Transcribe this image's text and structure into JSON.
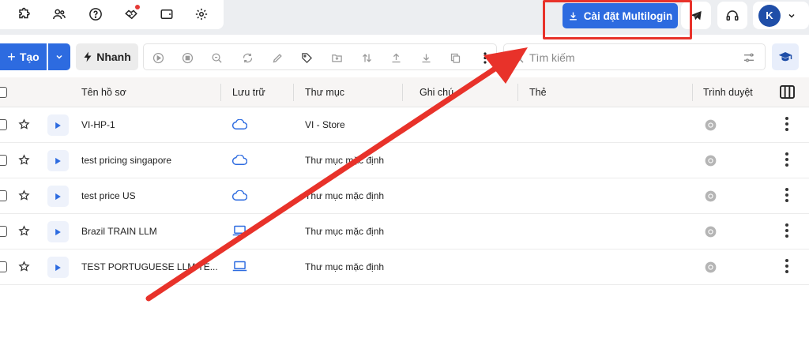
{
  "top_icons": [
    "puzzle-icon",
    "users-icon",
    "help-icon",
    "handshake-icon",
    "wallet-icon",
    "gear-icon"
  ],
  "install_button": {
    "label": "Cài đặt Multilogin",
    "icon": "download-icon"
  },
  "account": {
    "avatar_letter": "K"
  },
  "toolbar": {
    "create_label": "Tạo",
    "quick_label": "Nhanh",
    "action_icons": [
      "play-icon",
      "stop-icon",
      "zoom-icon",
      "refresh-icon",
      "pencil-icon",
      "tag-icon",
      "folder-move-icon",
      "transfer-icon",
      "upload-icon",
      "download-icon",
      "copy-icon",
      "more-icon"
    ]
  },
  "search": {
    "placeholder": "Tìm kiếm"
  },
  "table": {
    "headers": {
      "name": "Tên hồ sơ",
      "storage": "Lưu trữ",
      "folder": "Thư mục",
      "notes": "Ghi chú",
      "tags": "Thẻ",
      "browser": "Trình duyệt"
    },
    "rows": [
      {
        "name": "VI-HP-1",
        "storage": "cloud",
        "folder": "VI - Store"
      },
      {
        "name": "test pricing singapore",
        "storage": "cloud",
        "folder": "Thư mục mặc định"
      },
      {
        "name": "test price US",
        "storage": "cloud",
        "folder": "Thư mục mặc định"
      },
      {
        "name": "Brazil TRAIN LLM",
        "storage": "local",
        "folder": "Thư mục mặc định"
      },
      {
        "name": "TEST PORTUGUESE LLM TE...",
        "storage": "local",
        "folder": "Thư mục mặc định"
      }
    ]
  },
  "colors": {
    "accent": "#2d6be0",
    "annotation": "#e8322a"
  }
}
